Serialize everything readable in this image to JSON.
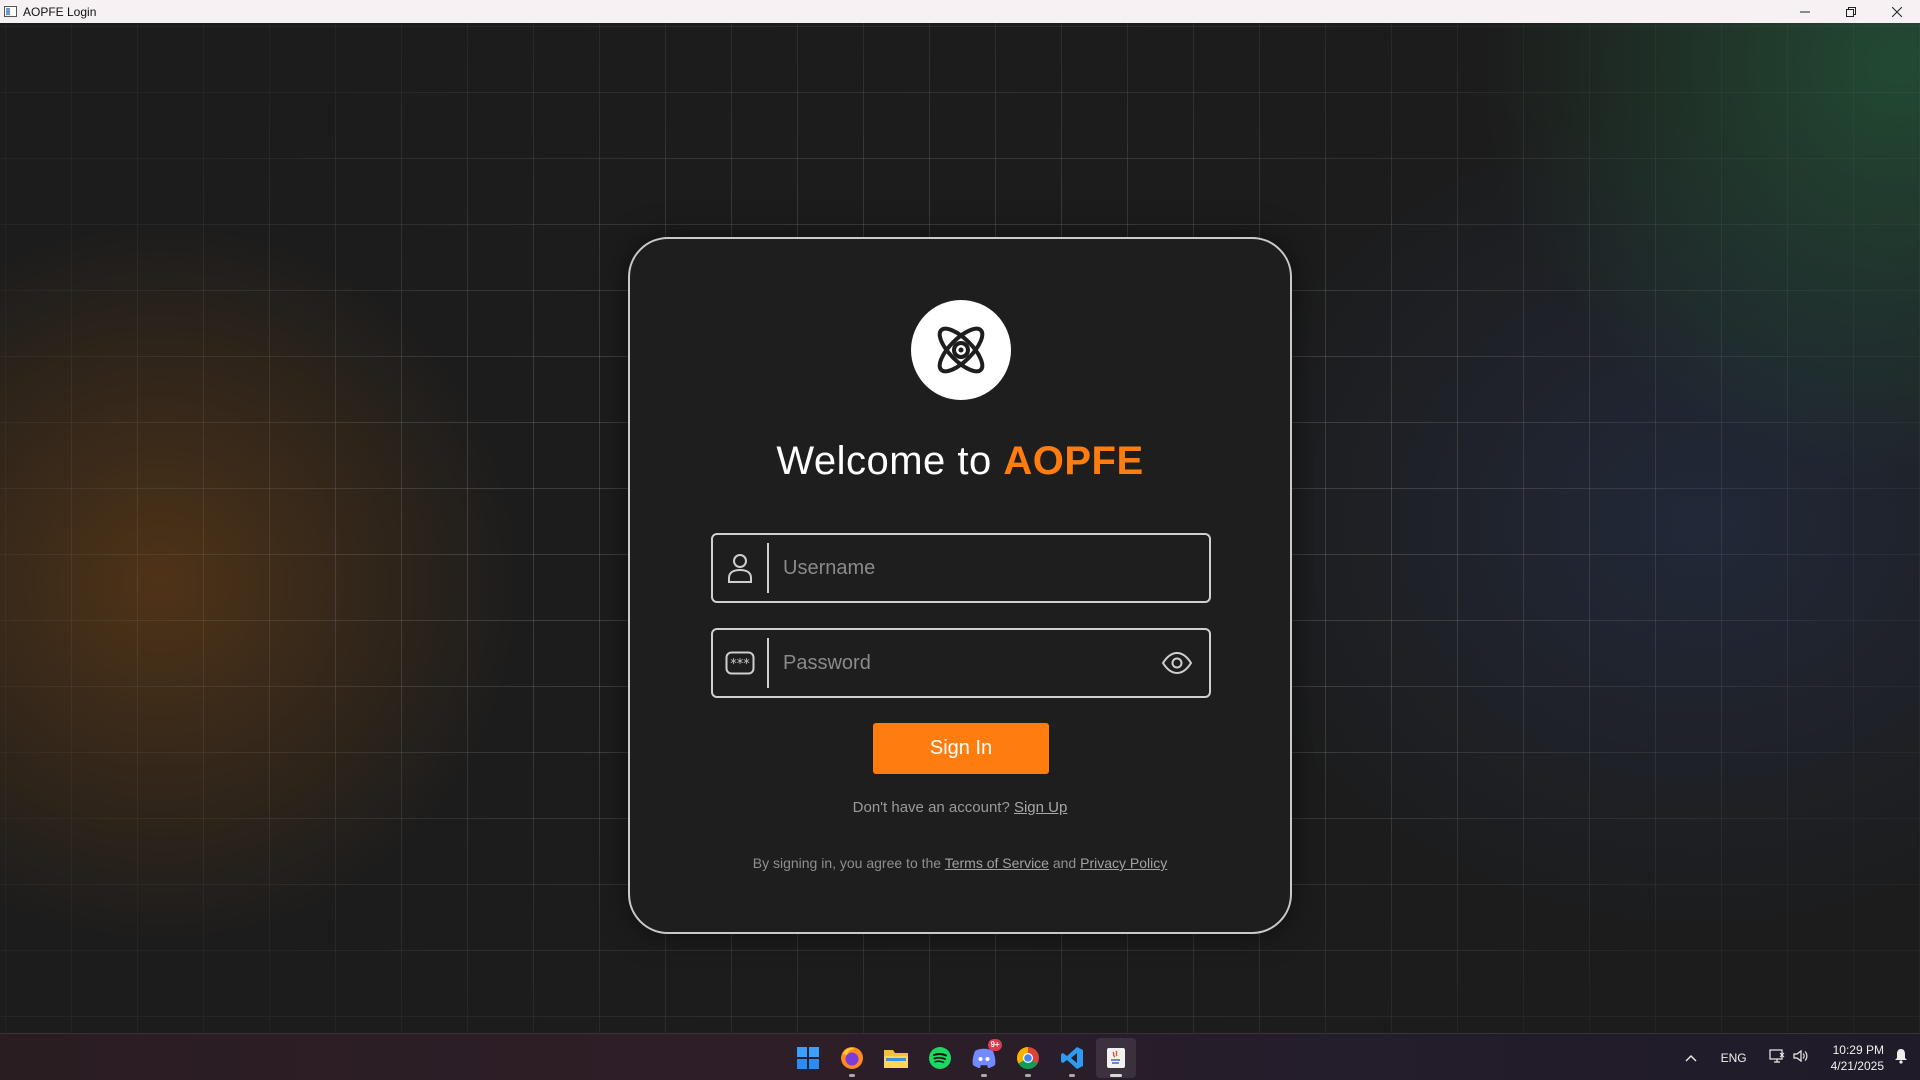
{
  "window": {
    "title": "AOPFE Login",
    "controls": [
      "minimize",
      "restore",
      "close"
    ]
  },
  "card": {
    "logo_icon": "atom-icon",
    "welcome_prefix": "Welcome to ",
    "brand": "AOPFE",
    "username": {
      "placeholder": "Username",
      "value": "",
      "icon": "user-icon"
    },
    "password": {
      "placeholder": "Password",
      "value": "",
      "icon": "password-dots-icon",
      "toggle_icon": "eye-icon"
    },
    "signin_label": "Sign In",
    "signup_prompt": "Don't have an account? ",
    "signup_link": "Sign Up",
    "legal_prefix": "By signing in, you agree to the ",
    "terms_link": "Terms of Service",
    "legal_and": " and ",
    "privacy_link": "Privacy Policy"
  },
  "colors": {
    "accent": "#ff7d0f",
    "card_bg": "#1e1e1e",
    "card_border": "#c9c9c9",
    "titlebar_bg": "#f7f1f3"
  },
  "taskbar": {
    "apps": [
      {
        "name": "windows-start-icon",
        "active": false
      },
      {
        "name": "firefox-icon",
        "active": false
      },
      {
        "name": "file-explorer-icon",
        "active": false
      },
      {
        "name": "spotify-icon",
        "active": false
      },
      {
        "name": "discord-icon",
        "active": false,
        "badge": "9+"
      },
      {
        "name": "chrome-icon",
        "active": false
      },
      {
        "name": "vscode-icon",
        "active": false
      },
      {
        "name": "java-app-icon",
        "active": true
      }
    ],
    "tray": {
      "language": "ENG",
      "time": "10:29 PM",
      "date": "4/21/2025"
    }
  }
}
